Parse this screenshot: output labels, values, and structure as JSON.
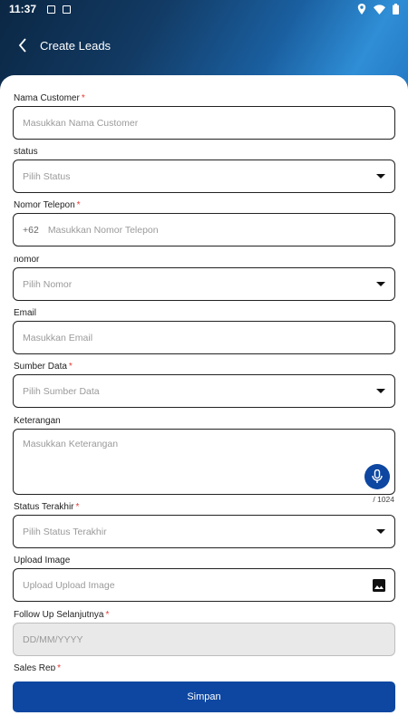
{
  "status_bar": {
    "time": "11:37"
  },
  "header": {
    "title": "Create Leads"
  },
  "form": {
    "nama_customer": {
      "label": "Nama Customer",
      "required": "*",
      "placeholder": "Masukkan Nama Customer"
    },
    "status": {
      "label": "status",
      "placeholder": "Pilih Status"
    },
    "nomor_telepon": {
      "label": "Nomor Telepon",
      "required": "*",
      "prefix": "+62",
      "placeholder": "Masukkan Nomor Telepon"
    },
    "nomor": {
      "label": "nomor",
      "placeholder": "Pilih Nomor"
    },
    "email": {
      "label": "Email",
      "placeholder": "Masukkan Email"
    },
    "sumber_data": {
      "label": "Sumber Data",
      "required": "*",
      "placeholder": "Pilih Sumber Data"
    },
    "keterangan": {
      "label": "Keterangan",
      "placeholder": "Masukkan Keterangan",
      "counter": "/ 1024"
    },
    "status_terakhir": {
      "label": "Status Terakhir",
      "required": "*",
      "placeholder": "Pilih Status Terakhir"
    },
    "upload_image": {
      "label": "Upload Image",
      "placeholder": "Upload Upload Image"
    },
    "follow_up": {
      "label": "Follow Up Selanjutnya",
      "required": "*",
      "placeholder": "DD/MM/YYYY"
    },
    "sales_rep": {
      "label": "Sales Rep",
      "required": "*"
    }
  },
  "actions": {
    "save_label": "Simpan"
  },
  "colors": {
    "primary": "#0d47a1",
    "required": "#e53935"
  },
  "icons": [
    "back-arrow-icon",
    "microphone-icon",
    "image-icon",
    "dropdown-caret-icon",
    "location-icon",
    "wifi-icon",
    "battery-icon"
  ]
}
